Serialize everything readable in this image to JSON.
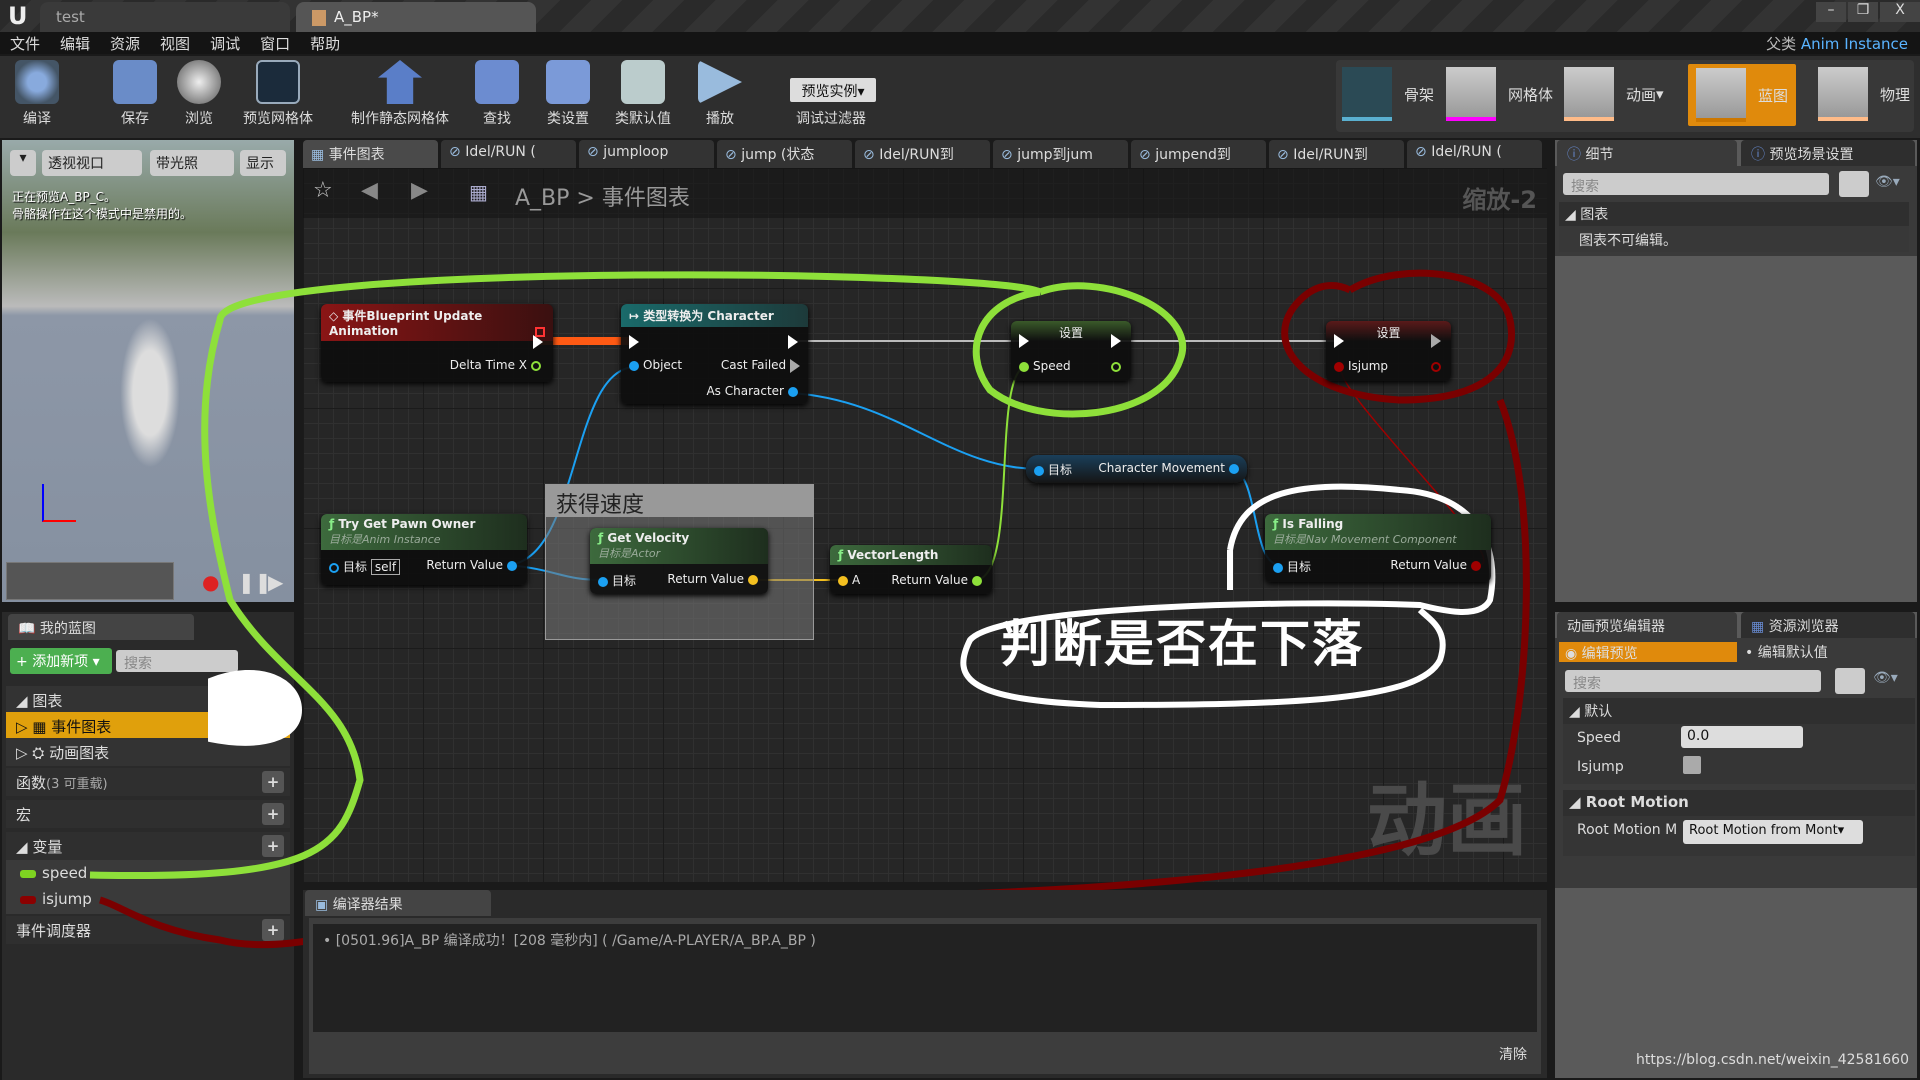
{
  "window": {
    "tabs": [
      "test",
      "A_BP*"
    ],
    "parent_label": "父类",
    "parent_value": "Anim Instance",
    "controls": [
      "–",
      "❐",
      "X"
    ]
  },
  "menu": [
    "文件",
    "编辑",
    "资源",
    "视图",
    "调试",
    "窗口",
    "帮助"
  ],
  "toolbar": {
    "buttons": [
      "编译",
      "保存",
      "浏览",
      "预览网格体",
      "制作静态网格体",
      "查找",
      "类设置",
      "类默认值",
      "播放"
    ],
    "debug_dropdown": "预览实例▾",
    "debug_label": "调试过滤器",
    "modes": [
      "骨架",
      "网格体",
      "动画",
      "蓝图",
      "物理"
    ],
    "active_mode": "蓝图"
  },
  "viewport": {
    "buttons": [
      "透视视口",
      "带光照",
      "显示"
    ],
    "msg1": "正在预览A_BP_C。",
    "msg2": "骨骼操作在这个模式中是禁用的。"
  },
  "my_blueprint": {
    "tab": "我的蓝图",
    "add_new": "添加新项",
    "search_placeholder": "搜索",
    "graph_section": "图表",
    "event_graph": "事件图表",
    "anim_graph": "动画图表",
    "functions": "函数",
    "functions_note": "(3 可重载)",
    "macros": "宏",
    "variables": "变量",
    "vars": [
      {
        "name": "speed",
        "color": "#7ed321"
      },
      {
        "name": "isjump",
        "color": "#8b0000"
      }
    ],
    "dispatchers": "事件调度器"
  },
  "graph_tabs": [
    "事件图表",
    "Idel/RUN (",
    "jumploop",
    "jump (状态",
    "Idel/RUN到",
    "jump到jum",
    "jumpend到",
    "Idel/RUN到",
    "Idel/RUN ("
  ],
  "breadcrumb": {
    "root": "A_BP",
    "sep": ">",
    "current": "事件图表"
  },
  "zoom": "缩放-2",
  "watermark": "动画",
  "nodes": {
    "event": {
      "title": "事件Blueprint Update Animation",
      "delta": "Delta Time X"
    },
    "cast": {
      "title": "类型转换为 Character",
      "object": "Object",
      "failed": "Cast Failed",
      "as": "As Character"
    },
    "set_speed": {
      "title": "设置",
      "var": "Speed"
    },
    "set_jump": {
      "title": "设置",
      "var": "Isjump"
    },
    "char_move": {
      "target": "目标",
      "out": "Character Movement"
    },
    "pawn": {
      "title": "Try Get Pawn Owner",
      "sub": "目标是Anim Instance",
      "target": "目标",
      "self": "self",
      "ret": "Return Value"
    },
    "comment": "获得速度",
    "velocity": {
      "title": "Get Velocity",
      "sub": "目标是Actor",
      "target": "目标",
      "ret": "Return Value"
    },
    "vlen": {
      "title": "VectorLength",
      "a": "A",
      "ret": "Return Value"
    },
    "falling": {
      "title": "Is Falling",
      "sub": "目标是Nav Movement Component",
      "target": "目标",
      "ret": "Return Value"
    }
  },
  "annotation": "判断是否在下落",
  "compiler": {
    "tab": "编译器结果",
    "log": "[0501.96]A_BP 编译成功！[208 毫秒内] ( /Game/A-PLAYER/A_BP.A_BP )",
    "clear": "清除"
  },
  "details": {
    "tabs": [
      "细节",
      "预览场景设置"
    ],
    "search_placeholder": "搜索",
    "section": "图表",
    "msg": "图表不可编辑。"
  },
  "anim_preview": {
    "tabs": [
      "动画预览编辑器",
      "资源浏览器"
    ],
    "edit_preview": "编辑预览",
    "edit_defaults": "编辑默认值",
    "search_placeholder": "搜索",
    "section": "默认",
    "speed_label": "Speed",
    "speed_value": "0.0",
    "isjump_label": "Isjump",
    "isjump_checked": false,
    "root_section": "Root Motion",
    "root_label": "Root Motion M",
    "root_value": "Root Motion from Mont▾"
  },
  "footer_url": "https://blog.csdn.net/weixin_42581660",
  "colors": {
    "accent": "#e08a0c",
    "exec": "#ffffff",
    "object_pin": "#1ba0f2",
    "float_pin": "#8ee03a",
    "bool_pin": "#a00000",
    "vector_pin": "#f4c020"
  }
}
